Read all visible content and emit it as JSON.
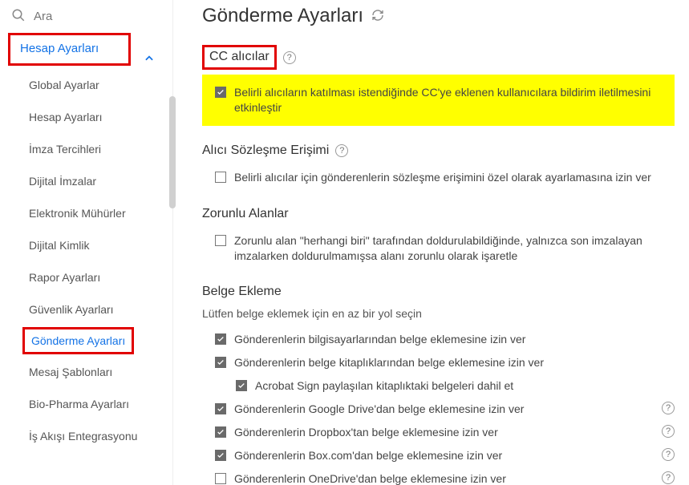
{
  "search": {
    "placeholder": "Ara"
  },
  "sidebar": {
    "group_label": "Hesap Ayarları",
    "items": [
      {
        "label": "Global Ayarlar"
      },
      {
        "label": "Hesap Ayarları"
      },
      {
        "label": "İmza Tercihleri"
      },
      {
        "label": "Dijital İmzalar"
      },
      {
        "label": "Elektronik Mühürler"
      },
      {
        "label": "Dijital Kimlik"
      },
      {
        "label": "Rapor Ayarları"
      },
      {
        "label": "Güvenlik Ayarları"
      },
      {
        "label": "Gönderme Ayarları"
      },
      {
        "label": "Mesaj Şablonları"
      },
      {
        "label": "Bio-Pharma Ayarları"
      },
      {
        "label": "İş Akışı Entegrasyonu"
      }
    ]
  },
  "page": {
    "title": "Gönderme Ayarları"
  },
  "sections": {
    "cc": {
      "title": "CC alıcılar",
      "option": "Belirli alıcıların katılması istendiğinde CC'ye eklenen kullanıcılara bildirim iletilmesini etkinleştir"
    },
    "access": {
      "title": "Alıcı Sözleşme Erişimi",
      "option": "Belirli alıcılar için gönderenlerin sözleşme erişimini özel olarak ayarlamasına izin ver"
    },
    "required": {
      "title": "Zorunlu Alanlar",
      "option": "Zorunlu alan \"herhangi biri\" tarafından doldurulabildiğinde, yalnızca son imzalayan imzalarken doldurulmamışsa alanı zorunlu olarak işaretle"
    },
    "attach": {
      "title": "Belge Ekleme",
      "intro": "Lütfen belge eklemek için en az bir yol seçin",
      "opts": {
        "computer": "Gönderenlerin bilgisayarlarından belge eklemesine izin ver",
        "library": "Gönderenlerin belge kitaplıklarından belge eklemesine izin ver",
        "shared": "Acrobat Sign paylaşılan kitaplıktaki belgeleri dahil et",
        "gdrive": "Gönderenlerin Google Drive'dan belge eklemesine izin ver",
        "dropbox": "Gönderenlerin Dropbox'tan belge eklemesine izin ver",
        "box": "Gönderenlerin Box.com'dan belge eklemesine izin ver",
        "onedrive": "Gönderenlerin OneDrive'dan belge eklemesine izin ver"
      }
    }
  }
}
